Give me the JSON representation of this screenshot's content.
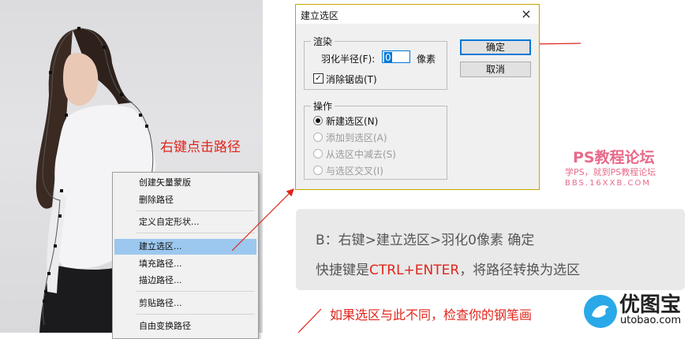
{
  "annotations": {
    "right_click_path": "右键点击路径",
    "bottom_note": "如果选区与此不同，检查你的钢笔画"
  },
  "context_menu": {
    "items": [
      {
        "label": "创建矢量蒙版",
        "highlighted": false
      },
      {
        "label": "删除路径",
        "highlighted": false
      },
      {
        "label": "定义自定形状...",
        "highlighted": false
      },
      {
        "label": "建立选区...",
        "highlighted": true
      },
      {
        "label": "填充路径...",
        "highlighted": false
      },
      {
        "label": "描边路径...",
        "highlighted": false
      },
      {
        "label": "剪贴路径...",
        "highlighted": false
      },
      {
        "label": "自由变换路径",
        "highlighted": false
      }
    ]
  },
  "dialog": {
    "title": "建立选区",
    "close_icon": "×",
    "render_group": {
      "legend": "渲染",
      "feather_label": "羽化半径(F):",
      "feather_value": "0",
      "feather_unit": "像素",
      "antialias_label": "消除锯齿(T)",
      "antialias_checked": true
    },
    "operation_group": {
      "legend": "操作",
      "options": [
        {
          "label": "新建选区(N)",
          "selected": true,
          "enabled": true
        },
        {
          "label": "添加到选区(A)",
          "selected": false,
          "enabled": false
        },
        {
          "label": "从选区中减去(S)",
          "selected": false,
          "enabled": false
        },
        {
          "label": "与选区交叉(I)",
          "selected": false,
          "enabled": false
        }
      ]
    },
    "ok_label": "确定",
    "cancel_label": "取消"
  },
  "watermark": {
    "line1": "PS教程论坛",
    "line2": "学PS，就到PS教程论坛",
    "line3": "BBS.16XXB.COM"
  },
  "info_box": {
    "line1": "B：右键>建立选区>羽化0像素 确定",
    "line2_prefix": "快捷键是",
    "line2_shortcut": "CTRL+ENTER",
    "line2_suffix": "，将路径转换为选区"
  },
  "logo": {
    "name": "优图宝",
    "url": "utobao.com"
  },
  "colors": {
    "annotation_red": "#e0251b",
    "menu_highlight": "#9cc8ef",
    "default_button_border": "#0078d7",
    "watermark_pink": "#e86a8a",
    "logo_blue": "#2aa8e8"
  }
}
